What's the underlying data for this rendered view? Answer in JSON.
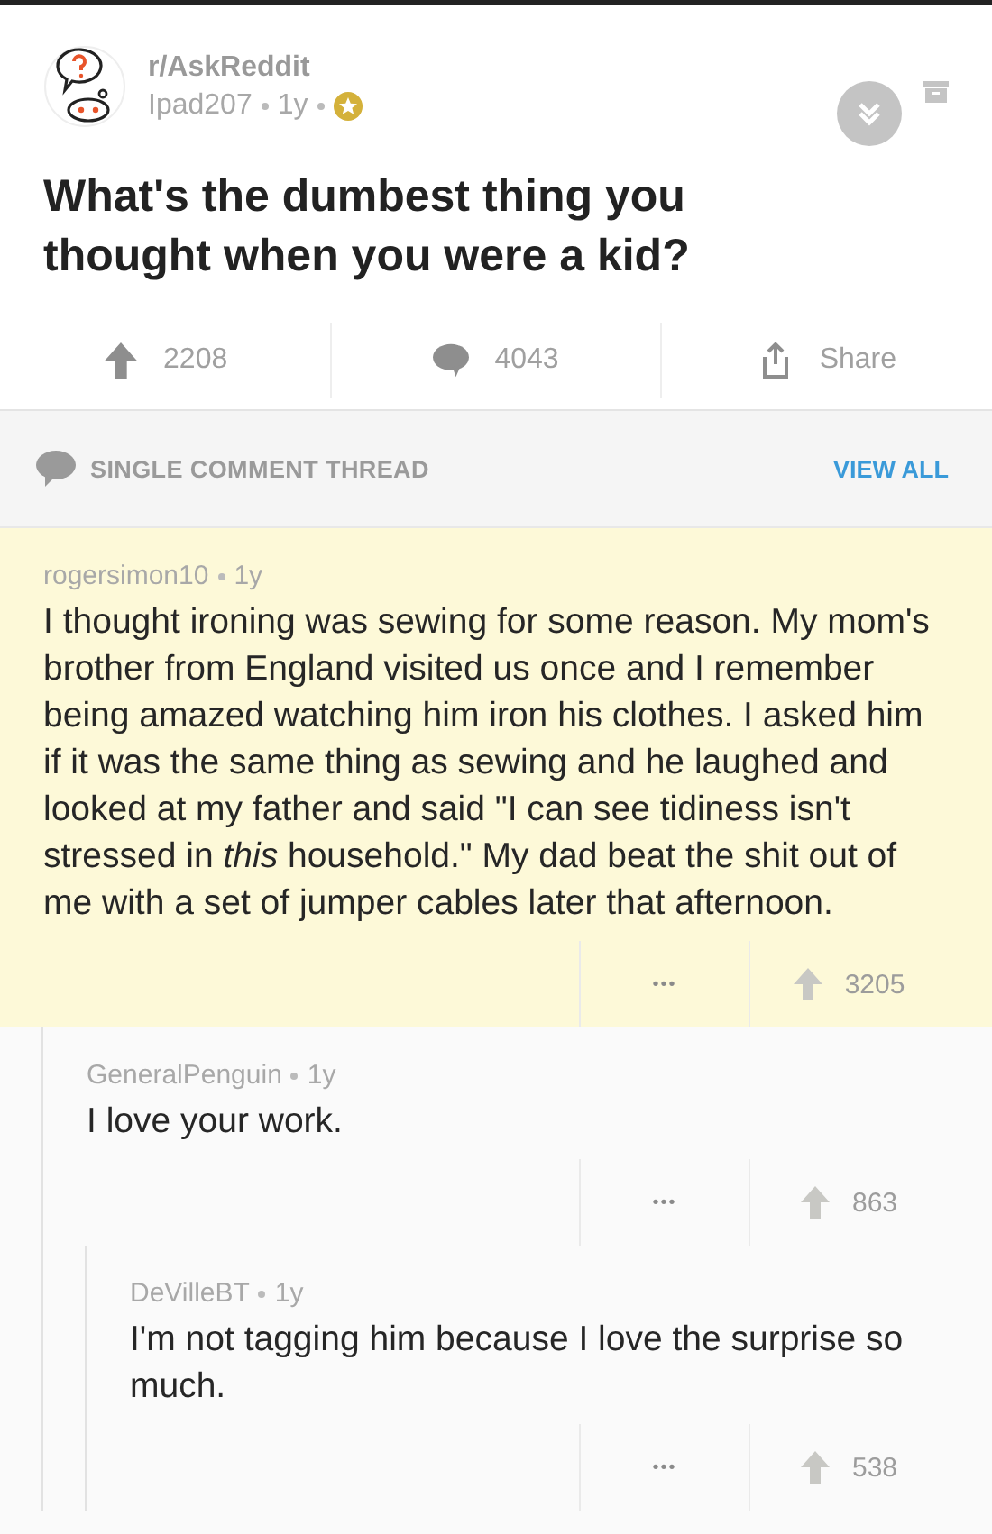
{
  "post": {
    "subreddit": "r/AskReddit",
    "author": "Ipad207",
    "age": "1y",
    "gilded": true,
    "title": "What's the dumbest thing you thought when you were a kid?",
    "upvotes": "2208",
    "comments": "4043",
    "share": "Share"
  },
  "thread_bar": {
    "label": "SINGLE COMMENT THREAD",
    "link": "VIEW ALL"
  },
  "comments": [
    {
      "author": "rogersimon10",
      "age": "1y",
      "highlighted": true,
      "body": "I thought ironing was sewing for some reason. My mom's brother from England visited us once and I remember being amazed watching him iron his clothes. I asked him if it was the same thing as sewing and he laughed and looked at my father and said \"I can see tidiness isn't stressed in *this* household.\" My dad beat the shit out of me with a set of jumper cables later that afternoon.",
      "more": "•••",
      "score": "3205",
      "children": [
        {
          "author": "GeneralPenguin",
          "age": "1y",
          "highlighted": false,
          "body": "I love your work.",
          "more": "•••",
          "score": "863",
          "children": [
            {
              "author": "DeVilleBT",
              "age": "1y",
              "highlighted": false,
              "body": "I'm not tagging him because I love the surprise so much.",
              "more": "•••",
              "score": "538"
            }
          ]
        }
      ]
    }
  ]
}
